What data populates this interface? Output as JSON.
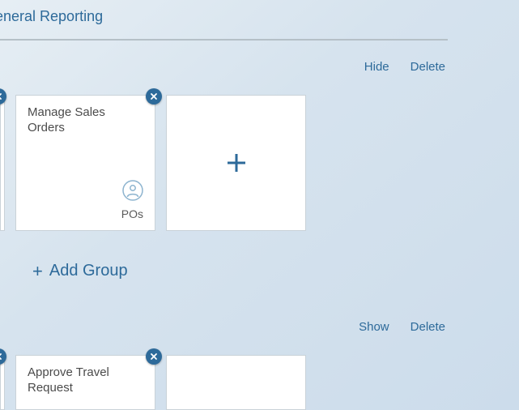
{
  "group1": {
    "title": "General Reporting",
    "actions": {
      "hide": "Hide",
      "delete": "Delete"
    },
    "tiles": {
      "manageSales": {
        "title": "Manage Sales Orders",
        "sub": "POs"
      }
    }
  },
  "addGroup": {
    "label": "Add Group"
  },
  "group2": {
    "actions": {
      "show": "Show",
      "delete": "Delete"
    },
    "tiles": {
      "approveTravel": {
        "title": "Approve Travel Request"
      }
    }
  },
  "colors": {
    "accent": "#2d6a9a"
  }
}
